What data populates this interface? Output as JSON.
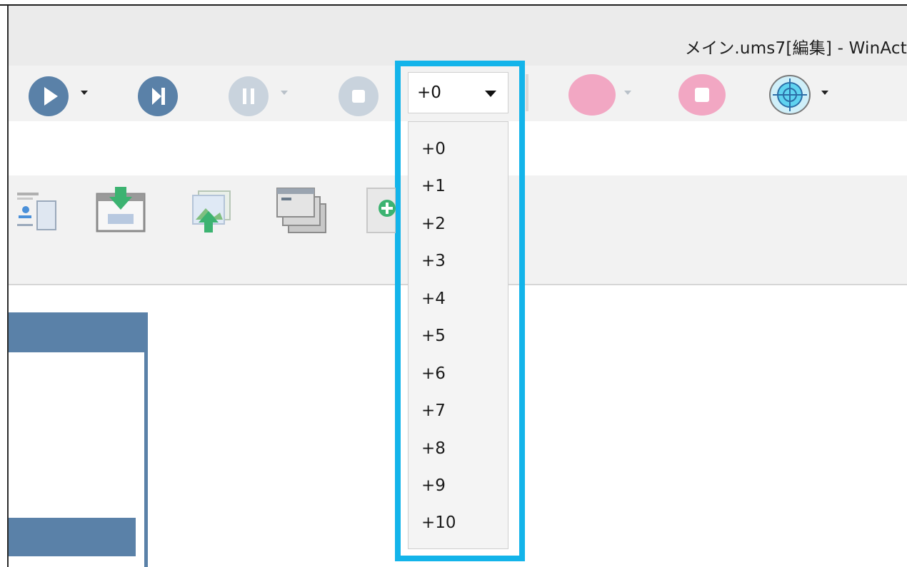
{
  "window": {
    "title": "メイン.ums7[編集] - WinAct"
  },
  "toolbar": {
    "speed_selected": "+0",
    "speed_options": [
      "+0",
      "+1",
      "+2",
      "+3",
      "+4",
      "+5",
      "+6",
      "+7",
      "+8",
      "+9",
      "+10"
    ]
  },
  "colors": {
    "accent_highlight": "#13b4ea",
    "playback_blue": "#5a81a8",
    "playback_disabled": "#c9d3dd",
    "record_pink": "#f2a7c3",
    "target_cyan": "#5fd3f0",
    "panel_header": "#5a81a8"
  },
  "icons": {
    "run": "play-icon",
    "step": "step-forward-icon",
    "pause": "pause-icon",
    "stop": "stop-icon",
    "record": "record-icon",
    "record_stop": "record-stop-icon",
    "target": "crosshair-target-icon"
  }
}
